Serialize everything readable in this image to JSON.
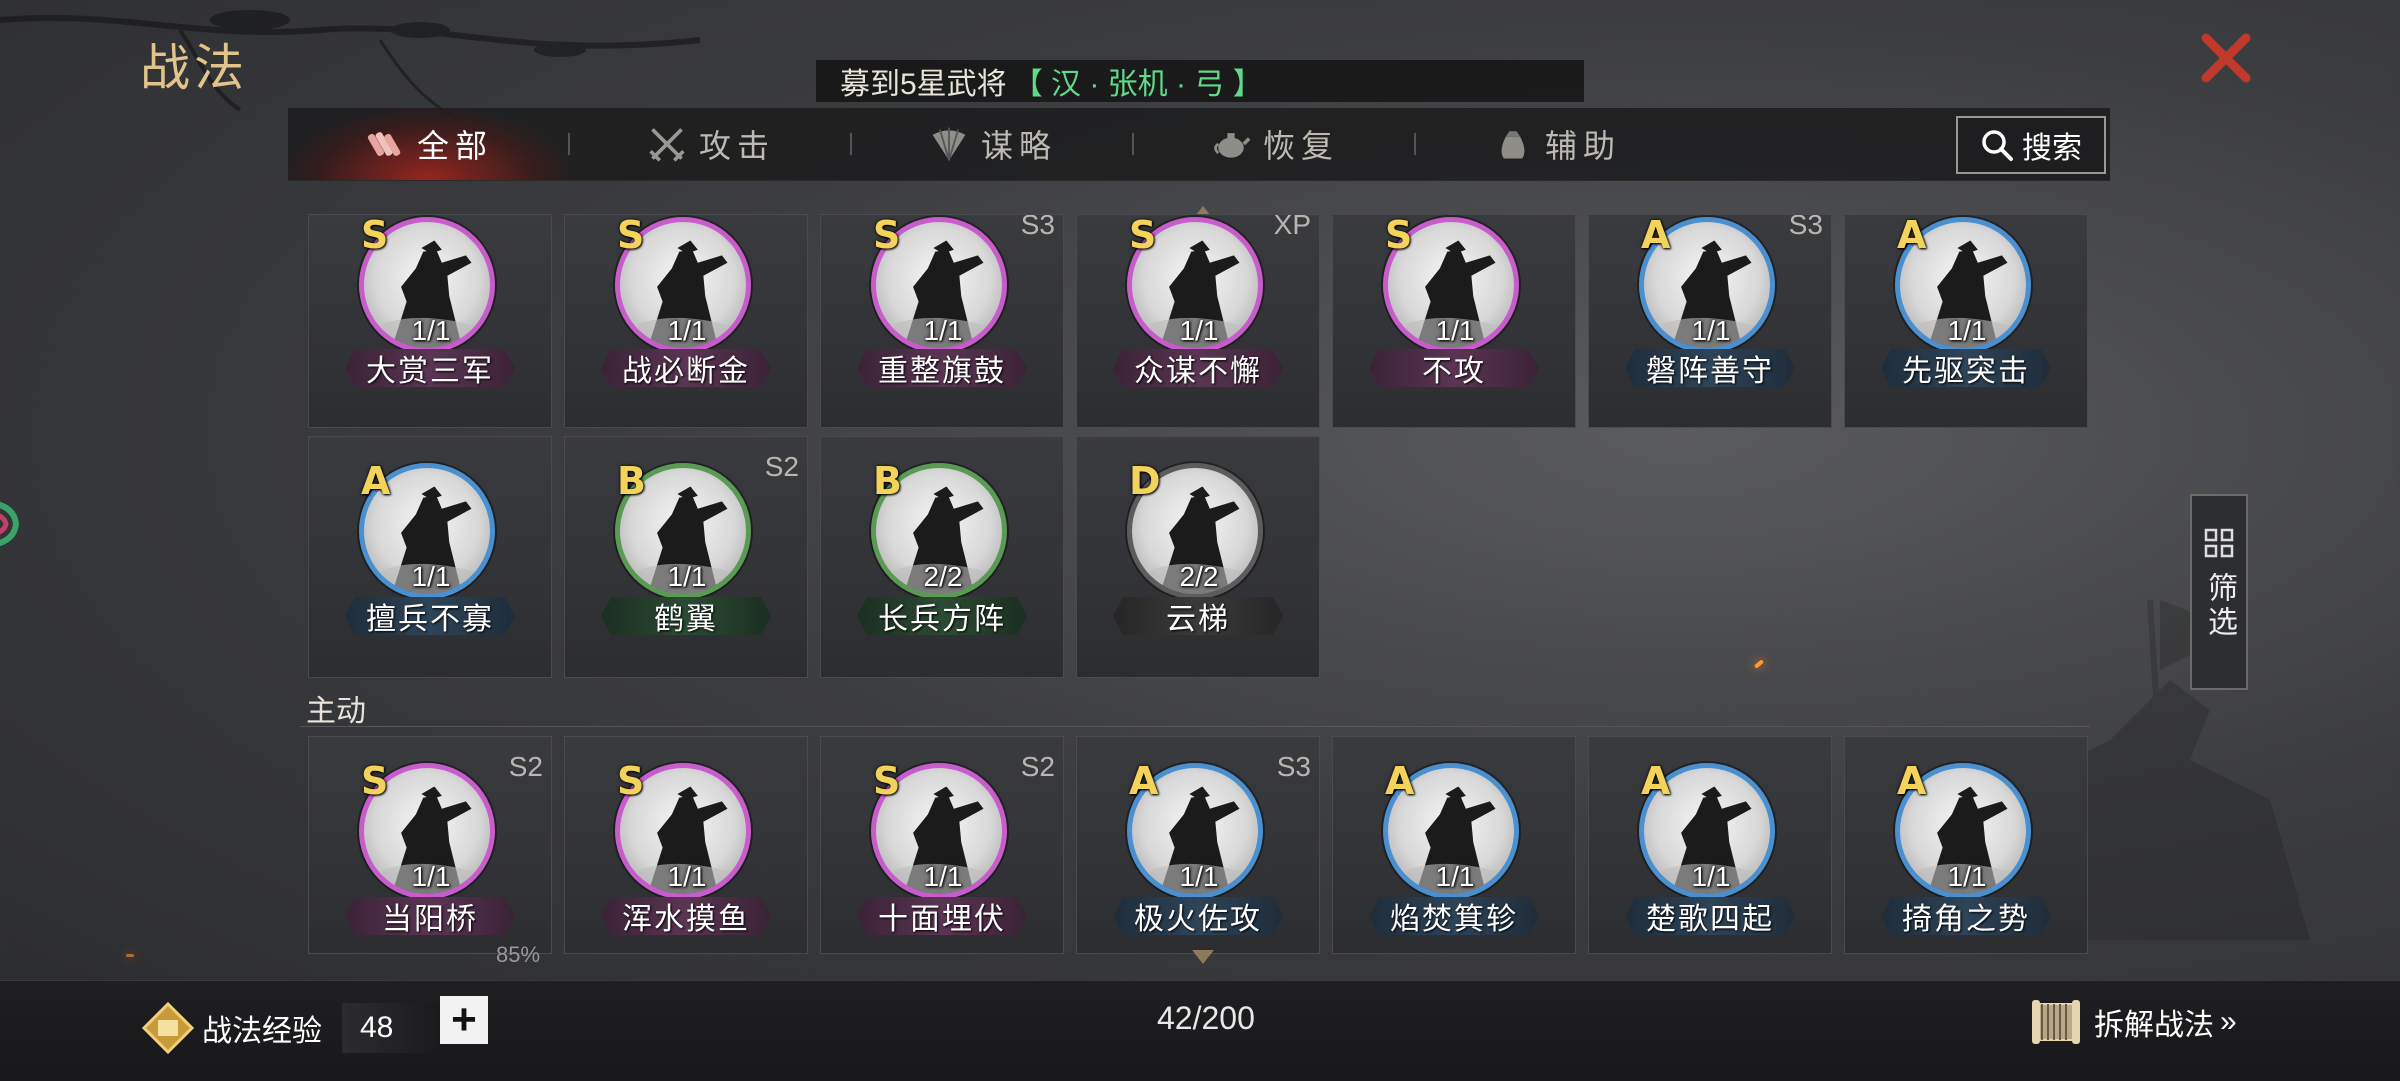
{
  "header": {
    "title": "战法",
    "banner_prefix": "募到5星武将",
    "banner_highlight": "【 汉 · 张机 · 弓 】"
  },
  "tabs": [
    {
      "label": "全部",
      "icon": "scroll-bundle-icon",
      "active": true
    },
    {
      "label": "攻击",
      "icon": "crossed-swords-icon",
      "active": false
    },
    {
      "label": "谋略",
      "icon": "fan-icon",
      "active": false
    },
    {
      "label": "恢复",
      "icon": "teapot-icon",
      "active": false
    },
    {
      "label": "辅助",
      "icon": "pouch-icon",
      "active": false
    }
  ],
  "search": {
    "label": "搜索"
  },
  "cards_row1": [
    {
      "name": "大赏三军",
      "grade": "S",
      "count": "1/1",
      "season": "",
      "color": "purple"
    },
    {
      "name": "战必断金",
      "grade": "S",
      "count": "1/1",
      "season": "",
      "color": "purple"
    },
    {
      "name": "重整旗鼓",
      "grade": "S",
      "count": "1/1",
      "season": "S3",
      "color": "purple"
    },
    {
      "name": "众谋不懈",
      "grade": "S",
      "count": "1/1",
      "season": "XP",
      "color": "purple"
    },
    {
      "name": "不攻",
      "grade": "S",
      "count": "1/1",
      "season": "",
      "color": "purple"
    },
    {
      "name": "磐阵善守",
      "grade": "A",
      "count": "1/1",
      "season": "S3",
      "color": "blue"
    },
    {
      "name": "先驱突击",
      "grade": "A",
      "count": "1/1",
      "season": "",
      "color": "blue"
    }
  ],
  "cards_row2": [
    {
      "name": "擅兵不寡",
      "grade": "A",
      "count": "1/1",
      "season": "",
      "color": "blue"
    },
    {
      "name": "鹤翼",
      "grade": "B",
      "count": "1/1",
      "season": "S2",
      "color": "green"
    },
    {
      "name": "长兵方阵",
      "grade": "B",
      "count": "2/2",
      "season": "",
      "color": "green"
    },
    {
      "name": "云梯",
      "grade": "D",
      "count": "2/2",
      "season": "",
      "color": "gray"
    }
  ],
  "section_active": {
    "label": "主动"
  },
  "cards_row3": [
    {
      "name": "当阳桥",
      "grade": "S",
      "count": "1/1",
      "season": "S2",
      "color": "purple"
    },
    {
      "name": "浑水摸鱼",
      "grade": "S",
      "count": "1/1",
      "season": "",
      "color": "purple"
    },
    {
      "name": "十面埋伏",
      "grade": "S",
      "count": "1/1",
      "season": "S2",
      "color": "purple"
    },
    {
      "name": "极火佐攻",
      "grade": "A",
      "count": "1/1",
      "season": "S3",
      "color": "blue"
    },
    {
      "name": "焰焚箕轸",
      "grade": "A",
      "count": "1/1",
      "season": "",
      "color": "blue"
    },
    {
      "name": "楚歌四起",
      "grade": "A",
      "count": "1/1",
      "season": "",
      "color": "blue"
    },
    {
      "name": "掎角之势",
      "grade": "A",
      "count": "1/1",
      "season": "",
      "color": "blue"
    }
  ],
  "partial_text": "85%",
  "filter": {
    "label": "筛选"
  },
  "footer": {
    "exp_label": "战法经验",
    "exp_value": "48",
    "plus_label": "+",
    "count_total": "42/200",
    "dismantle_label": "拆解战法",
    "dismantle_chevron": "»"
  },
  "colors": {
    "title_gold": "#e2c48a",
    "grade_yellow": "#f3d35a",
    "highlight_green": "#5fd98a",
    "ring_purple": "#c85ccc",
    "ring_blue": "#4a8fd0",
    "ring_green": "#5a9a55",
    "ring_gray": "#5c5c5c",
    "close_red": "#c0392b"
  }
}
